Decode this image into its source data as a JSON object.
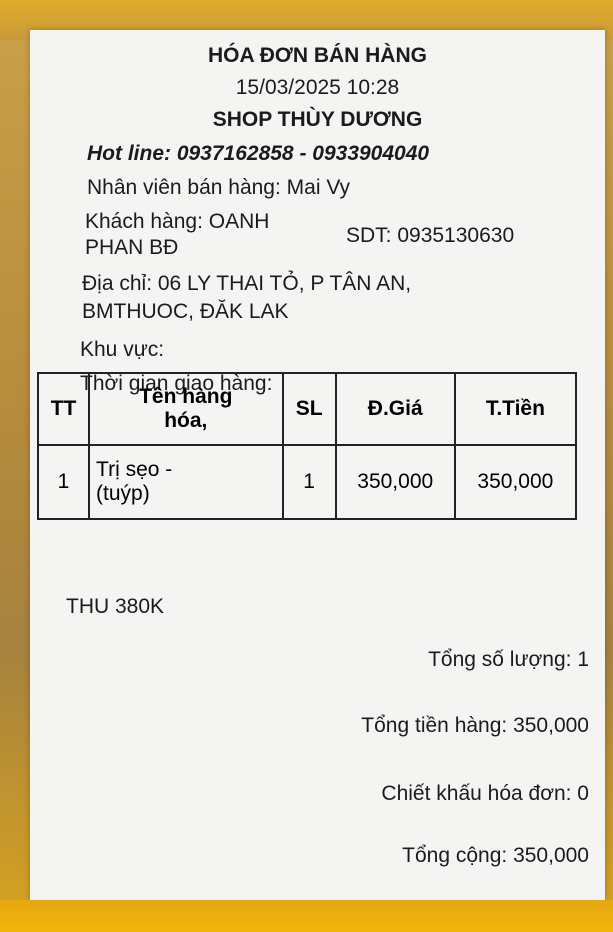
{
  "receipt": {
    "title": "HÓA ĐƠN BÁN HÀNG",
    "datetime": "15/03/2025 10:28",
    "shop_name": "SHOP THÙY DƯƠNG",
    "hotline": "Hot line: 0937162858 - 0933904040",
    "staff": "Nhân viên bán hàng: Mai Vy",
    "customer_line1": "Khách hàng: OANH",
    "customer_line2": "PHAN BĐ",
    "phone": "SDT: 0935130630",
    "address_line1": "Địa chỉ: 06 LY THAI TỎ, P TÂN AN,",
    "address_line2": "BMTHUOC, ĐĂK LAK",
    "area": "Khu vực:",
    "delivery_time": "Thời gian giao hàng:",
    "table": {
      "headers": {
        "tt": "TT",
        "name_line1": "Tên hàng",
        "name_line2": "hóa,",
        "qty": "SL",
        "price": "Đ.Giá",
        "total": "T.Tiền"
      },
      "rows": [
        {
          "tt": "1",
          "name_line1": "Trị sẹo -",
          "name_line2": "(tuýp)",
          "qty": "1",
          "price": "350,000",
          "total": "350,000"
        }
      ]
    },
    "note": "THU 380K",
    "total_qty": "Tổng số lượng: 1",
    "goods_total": "Tổng tiền hàng: 350,000",
    "discount": "Chiết khấu hóa đơn: 0",
    "grand_total": "Tổng cộng: 350,000"
  }
}
